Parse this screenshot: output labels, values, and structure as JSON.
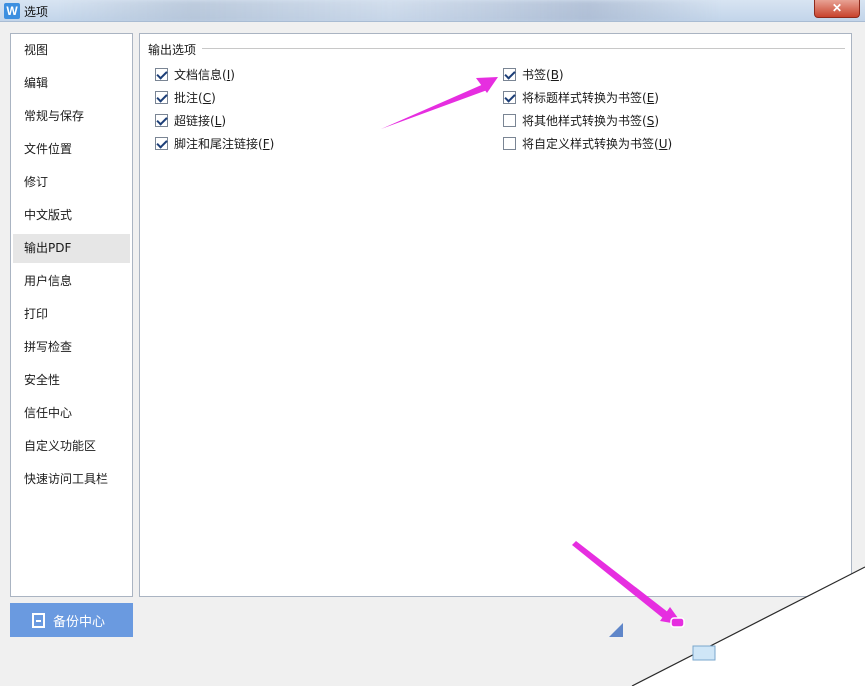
{
  "window": {
    "icon_glyph": "W",
    "title": "选项",
    "close_glyph": "✕"
  },
  "nav": {
    "items": [
      {
        "label": "视图"
      },
      {
        "label": "编辑"
      },
      {
        "label": "常规与保存"
      },
      {
        "label": "文件位置"
      },
      {
        "label": "修订"
      },
      {
        "label": "中文版式"
      },
      {
        "label": "输出PDF",
        "active": true
      },
      {
        "label": "用户信息"
      },
      {
        "label": "打印"
      },
      {
        "label": "拼写检查"
      },
      {
        "label": "安全性"
      },
      {
        "label": "信任中心"
      },
      {
        "label": "自定义功能区"
      },
      {
        "label": "快速访问工具栏"
      }
    ],
    "backup_label": "备份中心"
  },
  "output": {
    "group_title": "输出选项",
    "left_options": [
      {
        "text": "文档信息(",
        "key": "I",
        "tail": ")",
        "checked": true
      },
      {
        "text": "批注(",
        "key": "C",
        "tail": ")",
        "checked": true
      },
      {
        "text": "超链接(",
        "key": "L",
        "tail": ")",
        "checked": true
      },
      {
        "text": "脚注和尾注链接(",
        "key": "F",
        "tail": ")",
        "checked": true
      }
    ],
    "right_options": [
      {
        "text": "书签(",
        "key": "B",
        "tail": ")",
        "checked": true
      },
      {
        "text": "将标题样式转换为书签(",
        "key": "E",
        "tail": ")",
        "checked": true
      },
      {
        "text": "将其他样式转换为书签(",
        "key": "S",
        "tail": ")",
        "checked": false
      },
      {
        "text": "将自定义样式转换为书签(",
        "key": "U",
        "tail": ")",
        "checked": false
      }
    ]
  },
  "colors": {
    "accent": "#6a9ae0",
    "annotation_arrow": "#e62ee0"
  }
}
